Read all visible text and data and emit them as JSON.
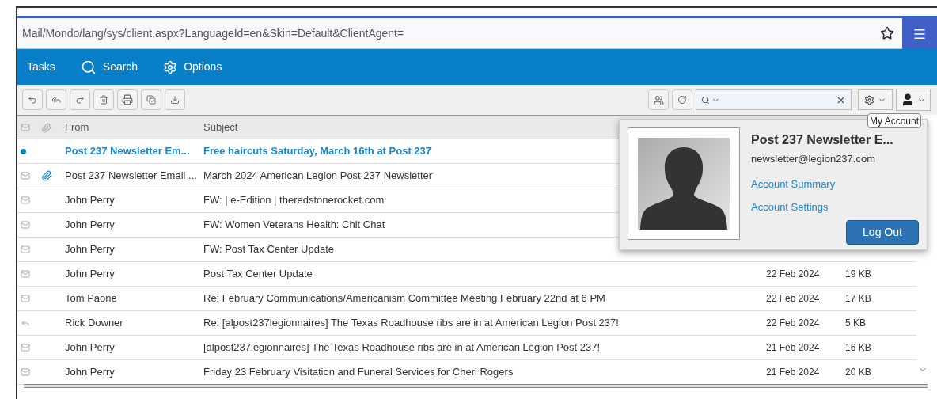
{
  "address_bar": {
    "url": "Mail/Mondo/lang/sys/client.aspx?LanguageId=en&Skin=Default&ClientAgent="
  },
  "nav": [
    {
      "label": "Tasks",
      "kind": "text"
    },
    {
      "label": "Search",
      "kind": "search"
    },
    {
      "label": "Options",
      "kind": "gear"
    }
  ],
  "tooltip": "My Account",
  "table": {
    "columns": [
      "From",
      "Subject"
    ],
    "rows": [
      {
        "kind": "unread",
        "attachment": false,
        "from": "Post 237 Newsletter Em...",
        "subject": "Free haircuts Saturday, March 16th at Post 237"
      },
      {
        "kind": "read",
        "attachment": true,
        "from": "Post 237 Newsletter Email ...",
        "subject": "March 2024 American Legion Post 237 Newsletter"
      },
      {
        "kind": "read",
        "attachment": false,
        "from": "John Perry",
        "subject": "FW: | e-Edition | theredstonerocket.com"
      },
      {
        "kind": "read",
        "attachment": false,
        "from": "John Perry",
        "subject": "FW: Women Veterans Health: Chit Chat"
      },
      {
        "kind": "read",
        "attachment": false,
        "from": "John Perry",
        "subject": "FW: Post Tax Center Update"
      },
      {
        "kind": "read",
        "attachment": false,
        "from": "John Perry",
        "subject": "Post Tax Center Update",
        "date": "22 Feb 2024",
        "size": "19 KB"
      },
      {
        "kind": "read",
        "attachment": false,
        "from": "Tom Paone",
        "subject": "Re: February Communications/Americanism Committee Meeting February 22nd at 6 PM",
        "date": "22 Feb 2024",
        "size": "17 KB"
      },
      {
        "kind": "replied",
        "attachment": false,
        "from": "Rick Downer",
        "subject": "Re: [alpost237legionnaires] The Texas Roadhouse ribs are in at American Legion Post 237!",
        "date": "22 Feb 2024",
        "size": "5 KB"
      },
      {
        "kind": "read",
        "attachment": false,
        "from": "John Perry",
        "subject": "[alpost237legionnaires] The Texas Roadhouse ribs are in at American Legion Post 237!",
        "date": "21 Feb 2024",
        "size": "16 KB"
      },
      {
        "kind": "read",
        "attachment": false,
        "from": "John Perry",
        "subject": "Friday 23 February Visitation and Funeral Services for Cheri Rogers",
        "date": "21 Feb 2024",
        "size": "20 KB"
      }
    ]
  },
  "account_popup": {
    "name": "Post 237 Newsletter E...",
    "email": "newsletter@legion237.com",
    "links": [
      "Account Summary",
      "Account Settings"
    ],
    "button": "Log Out"
  }
}
